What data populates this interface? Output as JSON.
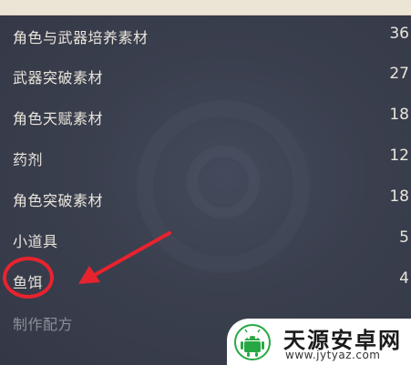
{
  "categories": [
    {
      "label": "角色与武器培养素材",
      "count": "36"
    },
    {
      "label": "武器突破素材",
      "count": "27"
    },
    {
      "label": "角色天赋素材",
      "count": "18"
    },
    {
      "label": "药剂",
      "count": "12"
    },
    {
      "label": "角色突破素材",
      "count": "18"
    },
    {
      "label": "小道具",
      "count": "5"
    },
    {
      "label": "鱼饵",
      "count": "4"
    },
    {
      "label": "制作配方",
      "count": ""
    }
  ],
  "annotation": {
    "circle_color": "#e8232e",
    "arrow_color": "#e8232e"
  },
  "watermark": {
    "title": "天源安卓网",
    "url": "www.jytyaz.com",
    "logo_icon": "android-robot-icon",
    "logo_color": "#27a845"
  }
}
